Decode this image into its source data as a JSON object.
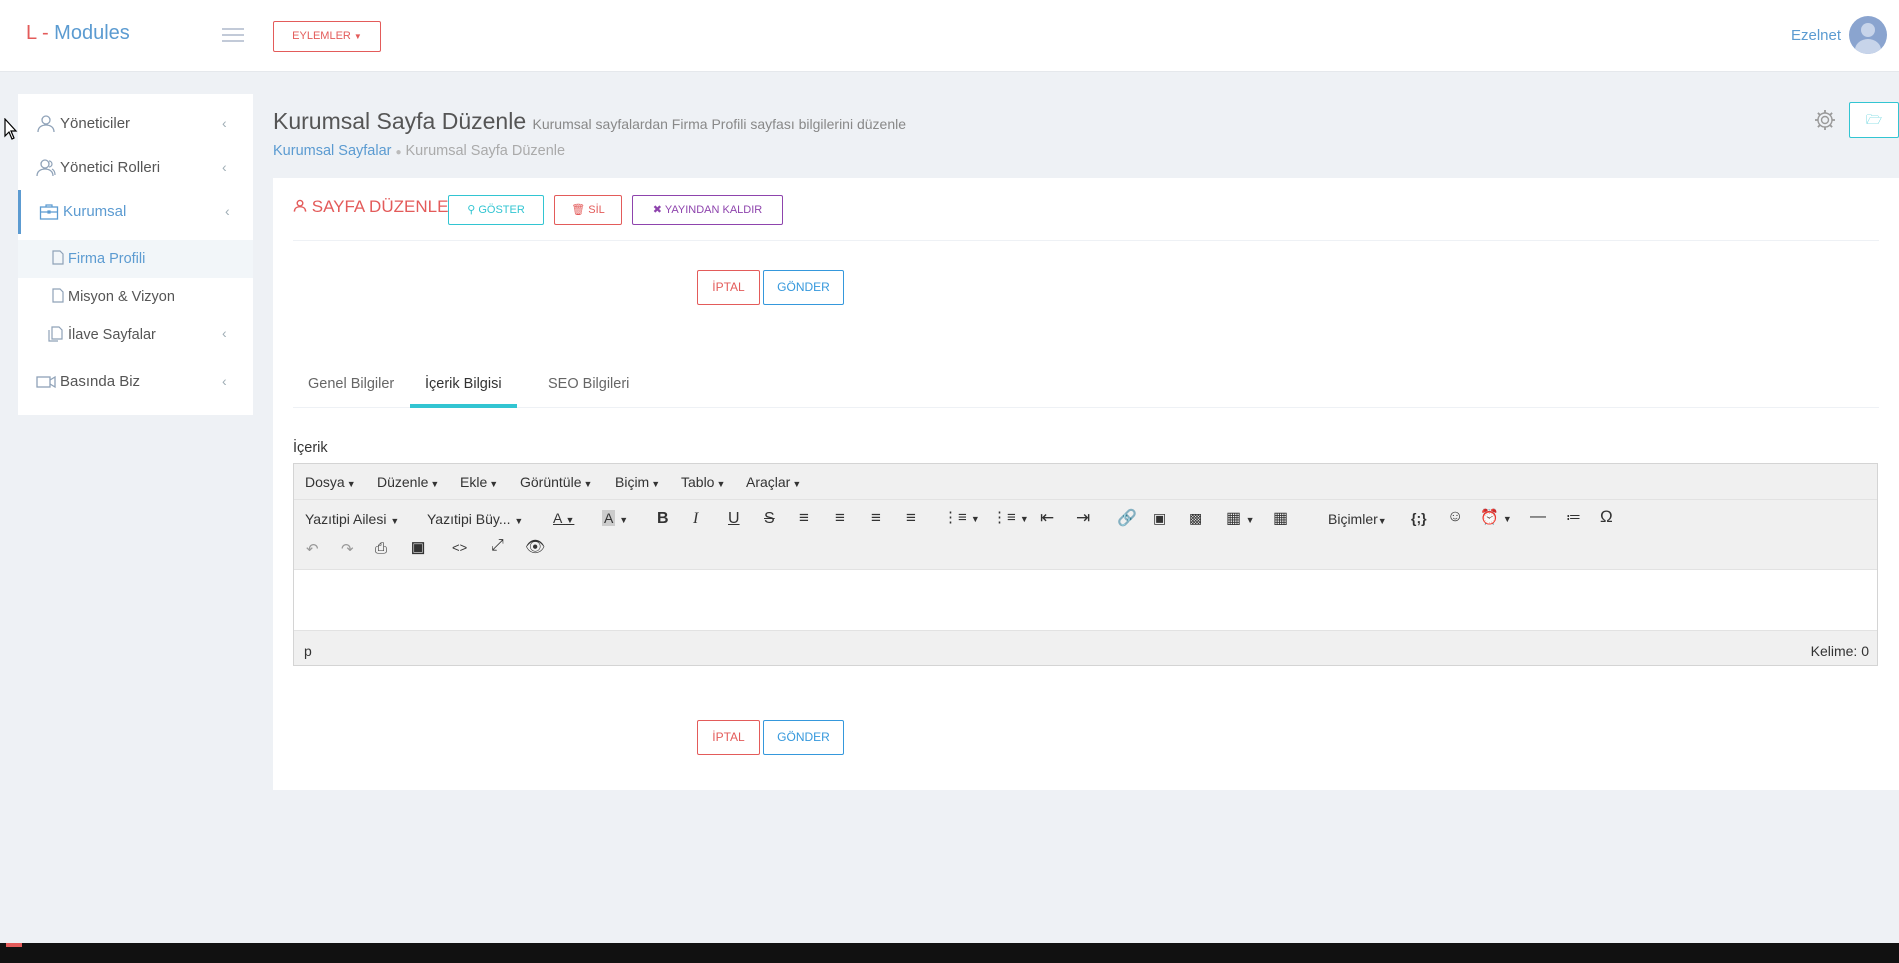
{
  "header": {
    "logo_prefix": "L",
    "logo_sep": " - ",
    "logo_text": "Modules",
    "actions_button": "EYLEMLER",
    "user_name": "Ezelnet"
  },
  "sidebar": {
    "items": [
      {
        "label": "Yöneticiler"
      },
      {
        "label": "Yönetici Rolleri"
      },
      {
        "label": "Kurumsal"
      },
      {
        "label": "Basında Biz"
      }
    ],
    "sub_items": [
      {
        "label": "Firma Profili"
      },
      {
        "label": "Misyon & Vizyon"
      },
      {
        "label": "İlave Sayfalar"
      }
    ]
  },
  "page": {
    "title": "Kurumsal Sayfa Düzenle",
    "subtitle": "Kurumsal sayfalardan Firma Profili sayfası bilgilerini düzenle",
    "breadcrumb": [
      "Kurumsal Sayfalar",
      "Kurumsal Sayfa Düzenle"
    ]
  },
  "card": {
    "title": "SAYFA DÜZENLE",
    "show_button": "GÖSTER",
    "delete_button": "SİL",
    "unpublish_button": "YAYINDAN KALDIR",
    "cancel_button": "İPTAL",
    "submit_button": "GÖNDER",
    "tabs": [
      "Genel Bilgiler",
      "İçerik Bilgisi",
      "SEO Bilgileri"
    ],
    "active_tab": "İçerik Bilgisi",
    "content_label": "İçerik"
  },
  "editor": {
    "menus": [
      "Dosya",
      "Düzenle",
      "Ekle",
      "Görüntüle",
      "Biçim",
      "Tablo",
      "Araçlar"
    ],
    "font_family": "Yazıtipi Ailesi",
    "font_size": "Yazıtipi Büy...",
    "formats": "Biçimler",
    "status_path": "p",
    "word_count": "Kelime: 0"
  },
  "colors": {
    "accent_blue": "#5b9bd1",
    "danger_red": "#e35b5a",
    "teal": "#32c5d2",
    "purple": "#8e44ad",
    "primary_blue": "#3598dc"
  }
}
